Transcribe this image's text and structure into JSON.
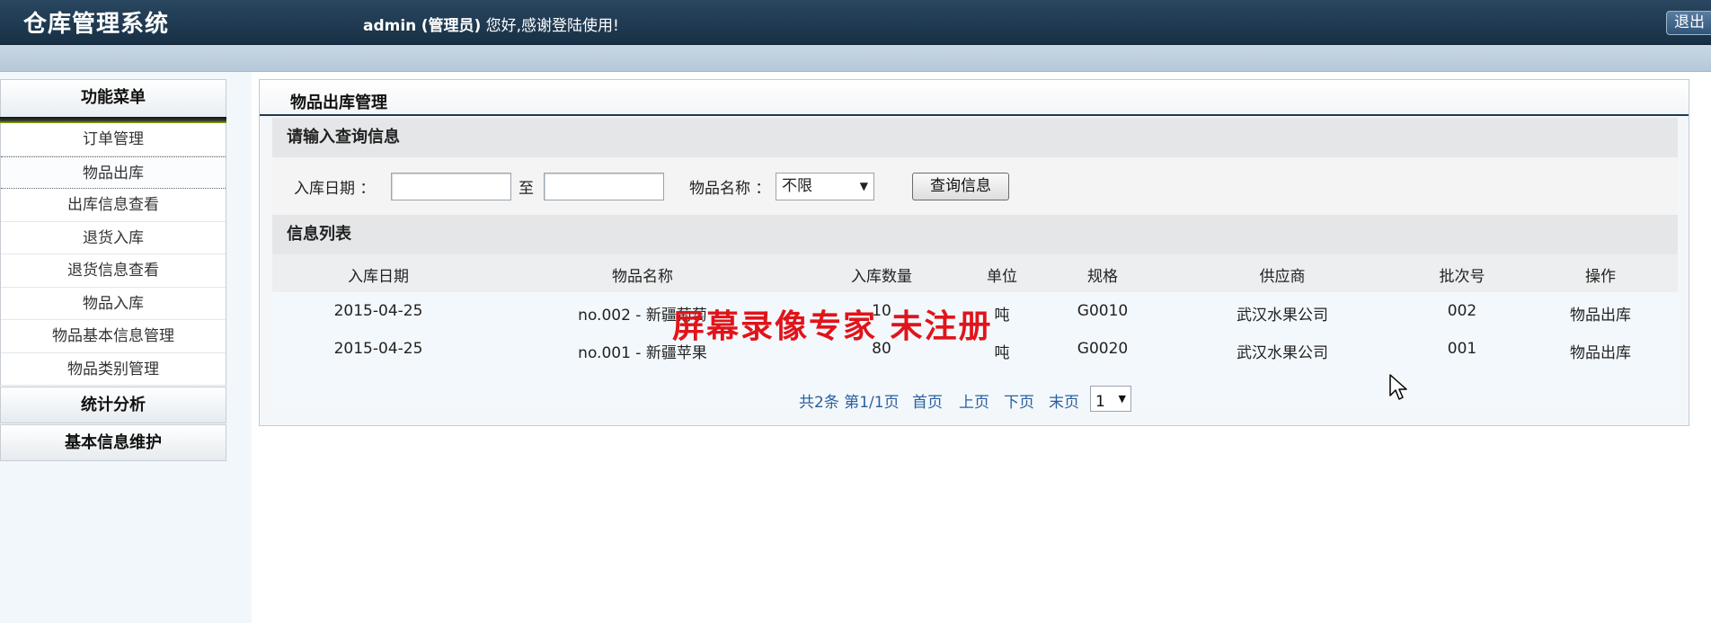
{
  "header": {
    "app_title": "仓库管理系统",
    "user": "admin",
    "role": "(管理员)",
    "greeting": "您好,感谢登陆使用!",
    "logout_label": "退出"
  },
  "sidebar": {
    "menu_title": "功能菜单",
    "items": [
      {
        "label": "订单管理"
      },
      {
        "label": "物品出库"
      },
      {
        "label": "出库信息查看"
      },
      {
        "label": "退货入库"
      },
      {
        "label": "退货信息查看"
      },
      {
        "label": "物品入库"
      },
      {
        "label": "物品基本信息管理"
      },
      {
        "label": "物品类别管理"
      }
    ],
    "groups": [
      {
        "label": "统计分析"
      },
      {
        "label": "基本信息维护"
      }
    ]
  },
  "main": {
    "panel_title": "物品出库管理",
    "query": {
      "section_title": "请输入查询信息",
      "date_label": "入库日期 ：",
      "date_from": "",
      "to_label": "至",
      "date_to": "",
      "name_label": "物品名称 ：",
      "name_value": "不限",
      "search_label": "查询信息"
    },
    "list": {
      "section_title": "信息列表",
      "columns": [
        "入库日期",
        "物品名称",
        "入库数量",
        "单位",
        "规格",
        "供应商",
        "批次号",
        "操作"
      ],
      "rows": [
        {
          "date": "2015-04-25",
          "name": "no.002 - 新疆葡萄",
          "qty": "10",
          "unit": "吨",
          "spec": "G0010",
          "supplier": "武汉水果公司",
          "batch": "002",
          "action": "物品出库"
        },
        {
          "date": "2015-04-25",
          "name": "no.001 - 新疆苹果",
          "qty": "80",
          "unit": "吨",
          "spec": "G0020",
          "supplier": "武汉水果公司",
          "batch": "001",
          "action": "物品出库"
        }
      ],
      "pager": {
        "summary": "共2条 第1/1页",
        "first": "首页",
        "prev": "上页",
        "next": "下页",
        "last": "末页",
        "page_value": "1"
      }
    }
  },
  "watermark": "屏幕录像专家  未注册",
  "icons": {
    "cursor": "mouse-pointer-icon",
    "dropdown": "chevron-down-icon"
  }
}
